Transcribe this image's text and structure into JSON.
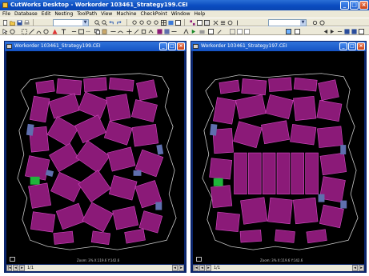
{
  "app": {
    "title": "CutWorks Desktop - Workorder 103461_Strategy199.CEI",
    "accent": "#0a4cc0"
  },
  "menu": {
    "items": [
      "File",
      "Database",
      "Edit",
      "Nesting",
      "ToolPath",
      "View",
      "Machine",
      "CheckPoint",
      "Window",
      "Help"
    ]
  },
  "windows": {
    "left": {
      "title": "Workorder 103461_Strategy199.CEI",
      "zoom_text": "Zoom: 3%  X:119.6  Y:142.6",
      "sheet_label": "1/1"
    },
    "right": {
      "title": "Workorder 103461_Strategy197.CEI",
      "zoom_text": "Zoom: 3%  X:119.6  Y:142.6",
      "sheet_label": "1/1"
    }
  },
  "colors": {
    "part_fill": "#8b1a78",
    "part_edge": "#d84ac6",
    "part_blue": "#5f6fae",
    "hide_outline": "#c8c8c8",
    "green_part": "#1fb53a",
    "canvas_bg": "#000000"
  },
  "icons": [
    "new-icon",
    "open-icon",
    "save-icon",
    "print-icon",
    "zoom-in-icon",
    "zoom-out-icon",
    "undo-icon",
    "redo-icon",
    "nest-icon",
    "cut-icon"
  ]
}
